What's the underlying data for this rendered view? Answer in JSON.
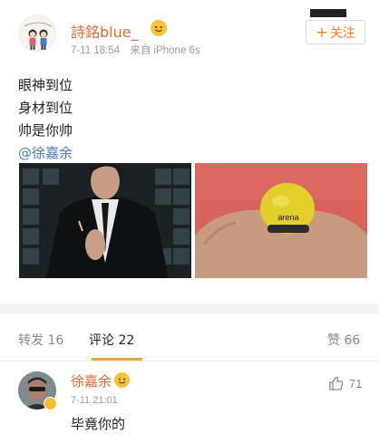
{
  "post": {
    "username": "詩銘blue_",
    "time": "7-11 18:54",
    "source": "来自 iPhone 6s",
    "follow_label": "关注",
    "follow_plus": "+",
    "lines": [
      "眼神到位",
      "身材到位",
      "帅是你帅"
    ],
    "mention": "@徐嘉余",
    "swimcap_text": "arena"
  },
  "tabs": {
    "repost_label": "转发",
    "repost_count": "16",
    "comments_label": "评论",
    "comments_count": "22",
    "likes_label": "赞",
    "likes_count": "66"
  },
  "comment": {
    "username": "徐嘉余",
    "time": "7-11 21:01",
    "text": "毕竟你的",
    "like_count": "71"
  },
  "colors": {
    "username": "#e2682e",
    "mention": "#4a7bbf",
    "accent": "#f5a623",
    "follow_text": "#ee8026"
  }
}
